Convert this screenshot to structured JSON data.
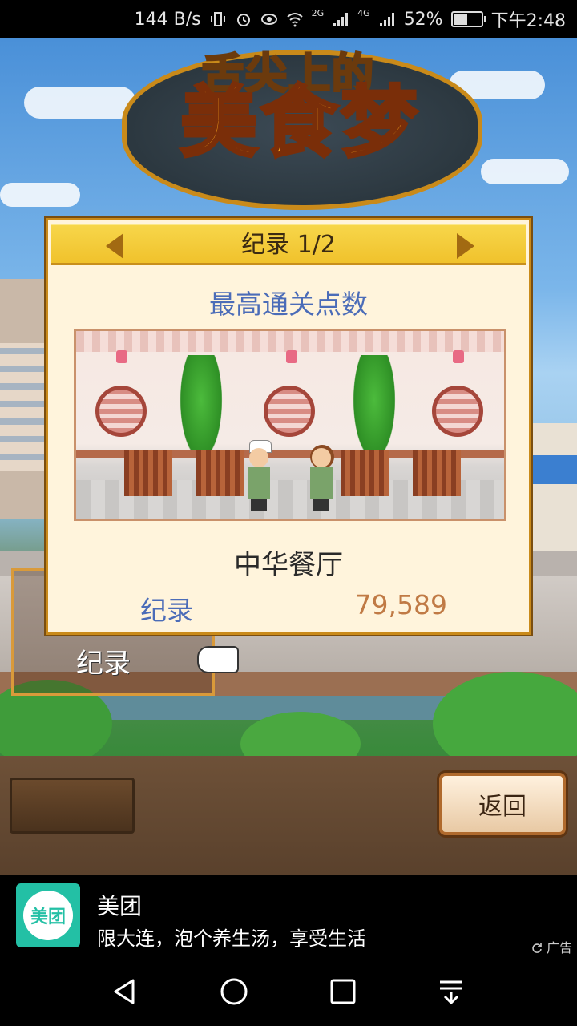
{
  "status_bar": {
    "net_speed": "144 B/s",
    "signal_2g": "2G",
    "signal_4g": "4G",
    "battery": "52%",
    "battery_level": 0.52,
    "time": "下午2:48"
  },
  "logo": {
    "top_text": "舌尖上的",
    "main_text": "美食梦"
  },
  "dialog": {
    "title": "纪录 1/2",
    "subtitle": "最高通关点数",
    "restaurant": "中华餐厅",
    "record_label": "纪录",
    "record_value": "79,589"
  },
  "background": {
    "record_button_label": "纪录"
  },
  "bottom": {
    "back_label": "返回"
  },
  "ad": {
    "logo_text": "美团",
    "title": "美团",
    "description": "限大连，泡个养生汤，享受生活",
    "tag": "广告"
  },
  "colors": {
    "accent_blue": "#4b6cb8",
    "record_value": "#c07a45",
    "header_gold": "#f0c22c",
    "meituan_green": "#23c0a5"
  }
}
